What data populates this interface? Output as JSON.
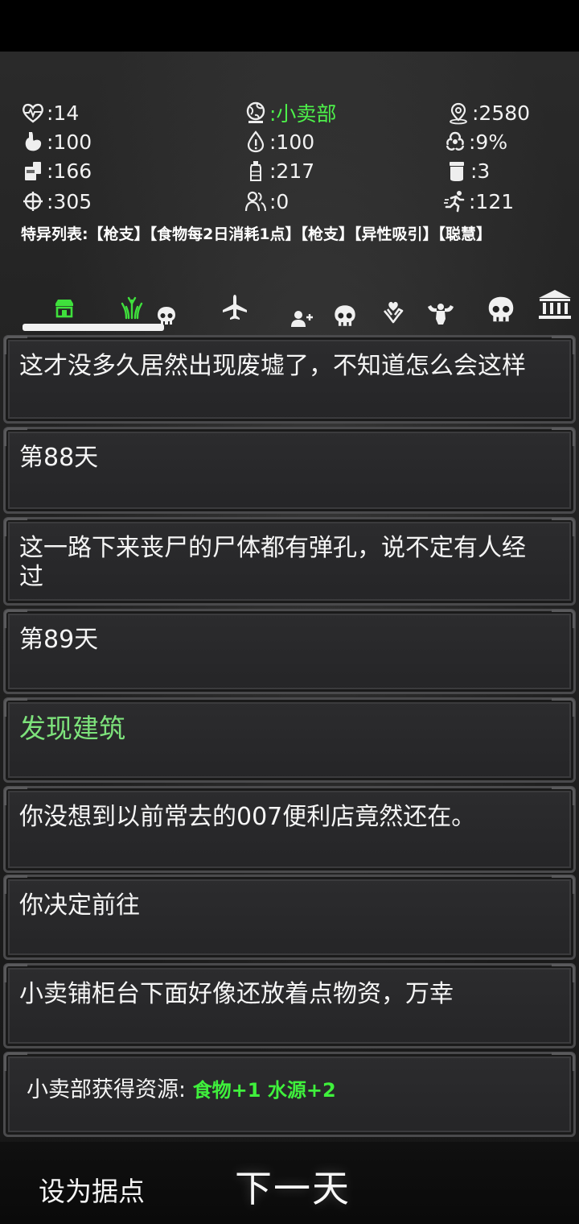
{
  "stats": {
    "health": ":14",
    "location": ":小卖部",
    "distance": ":2580",
    "hunger": ":100",
    "thirst": ":100",
    "infection": ":9%",
    "food": ":166",
    "water": ":217",
    "medicine": ":3",
    "accuracy": ":305",
    "survivors": ":0",
    "speed": ":121"
  },
  "traits": "特异列表:【枪支】【食物每2日消耗1点】【枪支】【异性吸引】【聪慧】",
  "tabs": [
    "shop",
    "grass",
    "skull",
    "plane",
    "add-user",
    "skull",
    "hand-heart",
    "muscle",
    "skull",
    "bank"
  ],
  "log": {
    "entry1": "这才没多久居然出现废墟了，不知道怎么会这样",
    "entry2": "第88天",
    "entry3": "这一路下来丧尸的尸体都有弹孔，说不定有人经过",
    "entry4": "第89天",
    "entry5": "发现建筑",
    "entry6": "你没想到以前常去的007便利店竟然还在。",
    "entry7": "你决定前往",
    "entry8": "小卖铺柜台下面好像还放着点物资，万幸",
    "entry9_prefix": "小卖部获得资源: ",
    "entry9_gain": "食物+1 水源+2"
  },
  "buttons": {
    "set_base": "设为据点",
    "next_day": "下一天"
  },
  "colors": {
    "accent_green": "#4df04a",
    "event_green": "#7de27b"
  }
}
